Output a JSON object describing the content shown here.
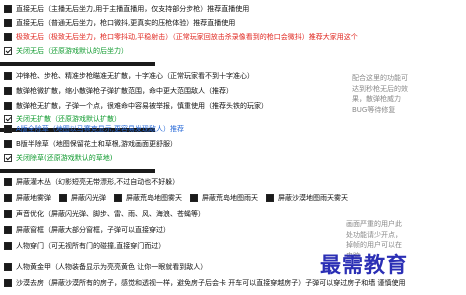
{
  "group1": [
    {
      "label": "直接无后（主播无后坐力,用于主播直播用，仅支持部分步枪）推荐直播使用",
      "checked": false,
      "color": "default"
    },
    {
      "label": "直接无后（普通无后坐力，枪口微抖,更真实的压枪体验）推荐直播使用",
      "checked": false,
      "color": "default"
    },
    {
      "label": "极致无后（极致无后坐力，枪口零抖动,平稳射击）（正常玩家回放击杀录像看到的枪口会微抖）推荐大家用这个",
      "checked": false,
      "color": "red"
    },
    {
      "label": "关闭无后（还原游戏默认的后坐力）",
      "checked": true,
      "color": "green"
    }
  ],
  "group2": [
    {
      "label": "冲锋枪、步枪、精准步枪瞄准无扩散，十字准心（正常玩家看不到十字准心）",
      "checked": false,
      "color": "default"
    },
    {
      "label": "散弹枪微扩散，缩小散弹枪子弹扩散范围，命中更大范围敌人（推荐）",
      "checked": false,
      "color": "default"
    },
    {
      "label": "散弹枪无扩散，子弹一个点，很难命中容易被举报，慎重使用（推荐头铁的玩家）",
      "checked": false,
      "color": "default"
    },
    {
      "label": "关闭无扩散（还原游戏默认扩散）",
      "checked": true,
      "color": "green"
    }
  ],
  "group2_note": [
    "配合这里的功能可",
    "达到秒枪无后的效",
    "果，散弹枪威力",
    "BUG等待修复"
  ],
  "group3": [
    {
      "label": "A版全除草（地图以马赛克显示,更容易发现敌人）推荐",
      "checked": false,
      "color": "blue"
    },
    {
      "label": "B版半除草（地图保留花土和草根,游戏画面更舒服）",
      "checked": false,
      "color": "default"
    },
    {
      "label": "关闭除草(还原游戏默认的草地)",
      "checked": true,
      "color": "green"
    }
  ],
  "group4": {
    "row1": {
      "label": "屏蔽灌木丛（幻影短亮无带漂形,不过自动也不好躲）",
      "checked": false
    },
    "row2": [
      {
        "label": "屏蔽地雾弹",
        "checked": false
      },
      {
        "label": "屏蔽闪光弹",
        "checked": false
      },
      {
        "label": "屏蔽荒岛地图雾天",
        "checked": false
      },
      {
        "label": "屏蔽荒岛地图雨天",
        "checked": false
      },
      {
        "label": "屏蔽沙漠地图雨天雾天",
        "checked": false
      }
    ],
    "row3": {
      "label": "声音优化（屏蔽闪光弹、脚步、雷、雨、风、海浪、苍蝇等）",
      "checked": false
    },
    "row4": {
      "label": "屏蔽窗框（屏蔽大部分窗框，子弹可以直接穿过）",
      "checked": false
    },
    "row5": {
      "label": "人物穿门（可无视所有门的碰撞,直接穿门而过）",
      "checked": false
    },
    "row6": {
      "label": "人物黄金甲（人物装备显示为亮亮黄色 让你一眼就看到敌人）",
      "checked": false
    },
    "row7": {
      "label": "沙漠去房（屏蔽沙漠所有的房子，感觉和透视一样，避免房子后会卡 开车可以直接穿越房子）子弹可以穿过房子和墙 谨慎使用",
      "checked": false
    }
  },
  "group4_note": [
    "画面严重的用户此",
    "处功能请少开点，",
    "掉帧的用户可以在",
    "电脑"
  ],
  "watermark": "最需教育"
}
